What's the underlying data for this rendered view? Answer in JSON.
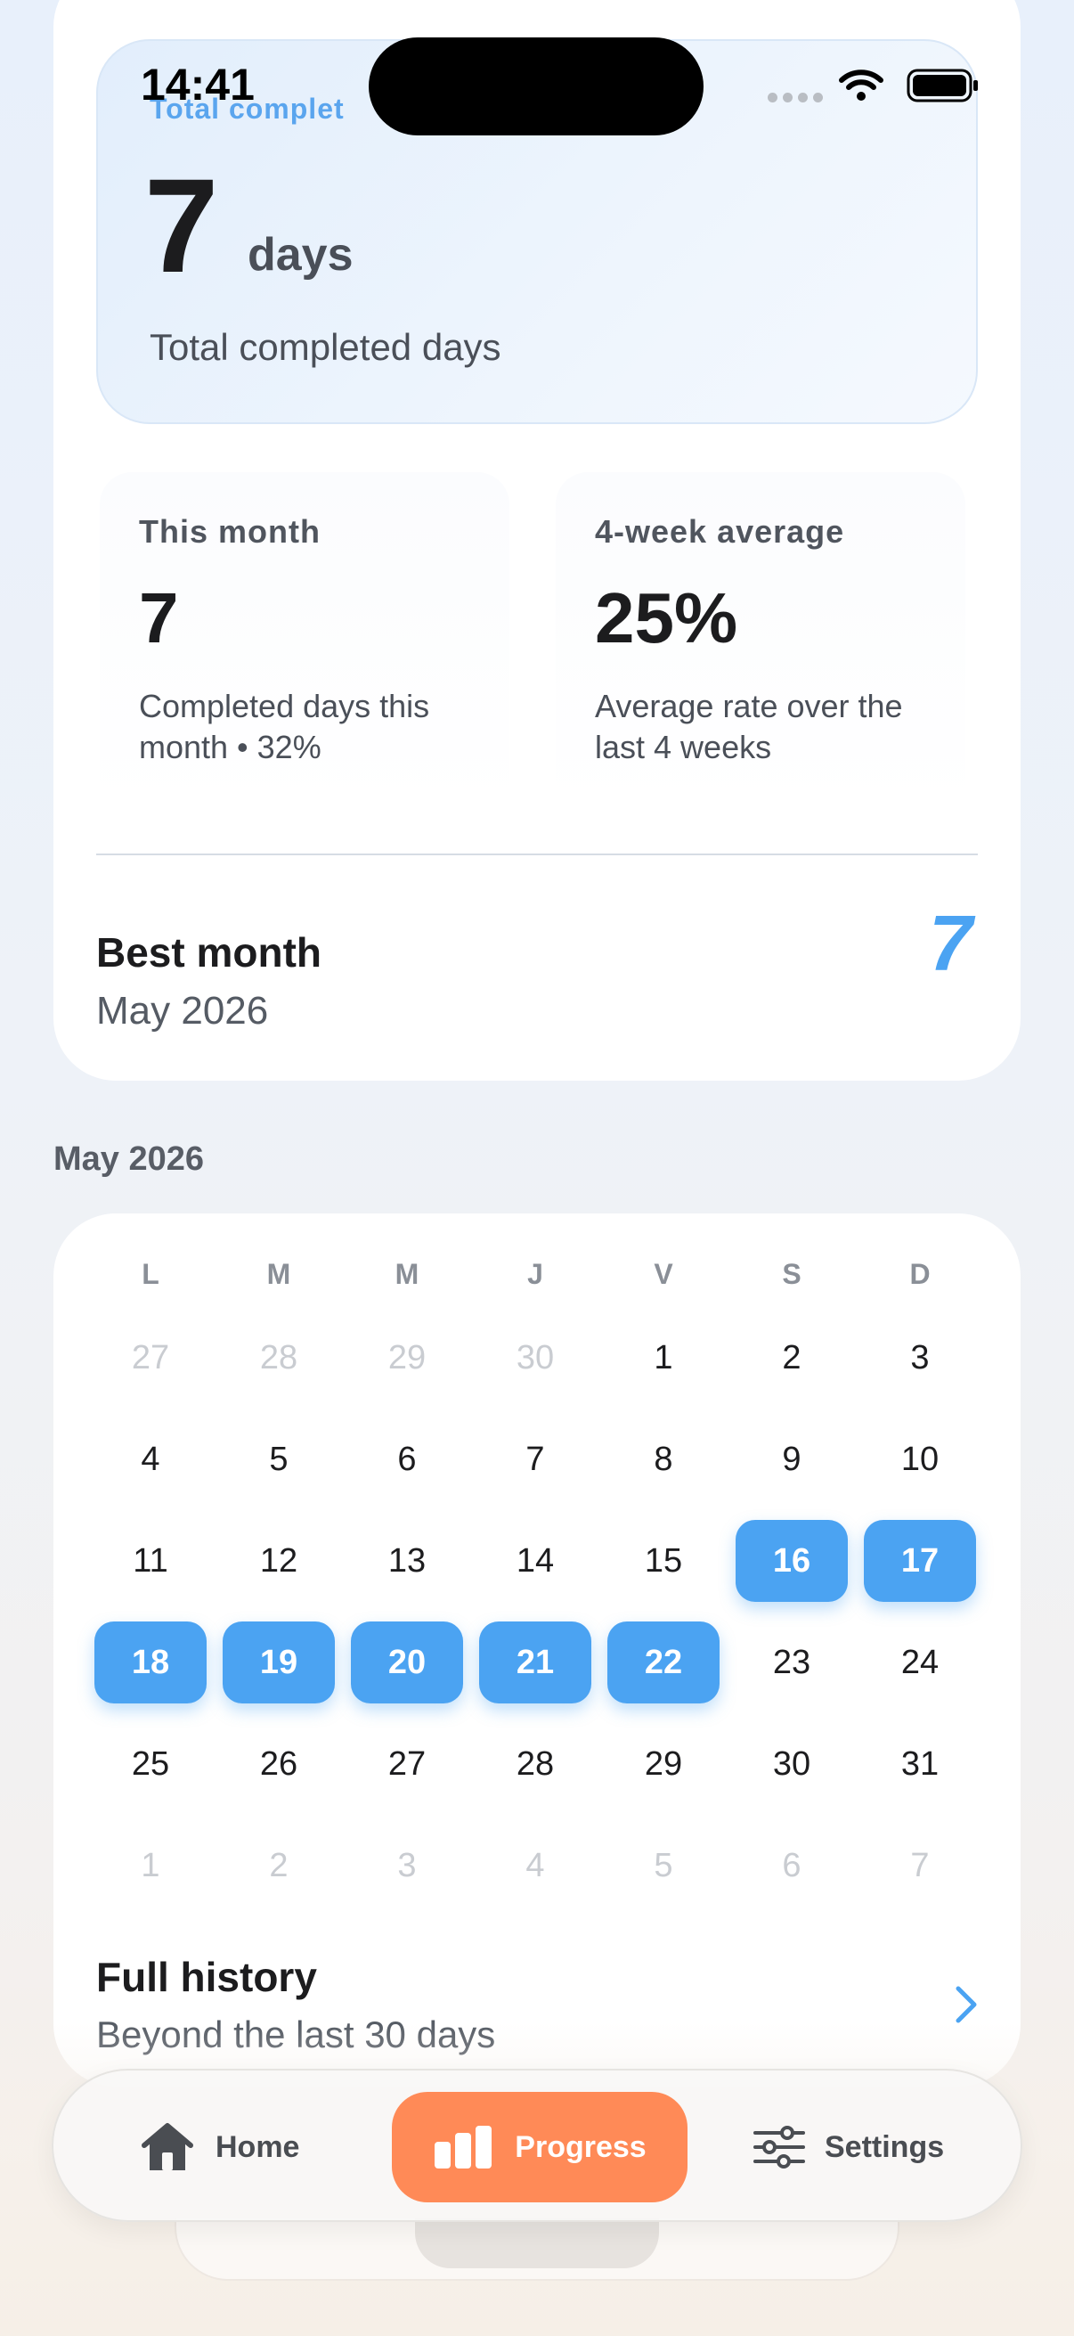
{
  "status_bar": {
    "time": "14:41"
  },
  "summary": {
    "eyebrow": "Total complet",
    "total_value": "7",
    "total_unit": "days",
    "total_caption": "Total completed days",
    "this_month": {
      "title": "This month",
      "value": "7",
      "description": "Completed days this month • 32%"
    },
    "four_week": {
      "title": "4-week average",
      "value": "25%",
      "description": "Average rate over the last 4 weeks"
    },
    "best_month": {
      "title": "Best month",
      "subtitle": "May 2026",
      "value": "7"
    }
  },
  "calendar": {
    "month_label": "May 2026",
    "weekdays": [
      "L",
      "M",
      "M",
      "J",
      "V",
      "S",
      "D"
    ],
    "weeks": [
      [
        {
          "d": "27",
          "muted": true
        },
        {
          "d": "28",
          "muted": true
        },
        {
          "d": "29",
          "muted": true
        },
        {
          "d": "30",
          "muted": true
        },
        {
          "d": "1"
        },
        {
          "d": "2"
        },
        {
          "d": "3"
        }
      ],
      [
        {
          "d": "4"
        },
        {
          "d": "5"
        },
        {
          "d": "6"
        },
        {
          "d": "7"
        },
        {
          "d": "8"
        },
        {
          "d": "9"
        },
        {
          "d": "10"
        }
      ],
      [
        {
          "d": "11"
        },
        {
          "d": "12"
        },
        {
          "d": "13"
        },
        {
          "d": "14"
        },
        {
          "d": "15"
        },
        {
          "d": "16",
          "done": true
        },
        {
          "d": "17",
          "done": true
        }
      ],
      [
        {
          "d": "18",
          "done": true
        },
        {
          "d": "19",
          "done": true
        },
        {
          "d": "20",
          "done": true
        },
        {
          "d": "21",
          "done": true
        },
        {
          "d": "22",
          "done": true
        },
        {
          "d": "23"
        },
        {
          "d": "24"
        }
      ],
      [
        {
          "d": "25"
        },
        {
          "d": "26"
        },
        {
          "d": "27"
        },
        {
          "d": "28"
        },
        {
          "d": "29"
        },
        {
          "d": "30"
        },
        {
          "d": "31"
        }
      ],
      [
        {
          "d": "1",
          "muted": true
        },
        {
          "d": "2",
          "muted": true
        },
        {
          "d": "3",
          "muted": true
        },
        {
          "d": "4",
          "muted": true
        },
        {
          "d": "5",
          "muted": true
        },
        {
          "d": "6",
          "muted": true
        },
        {
          "d": "7",
          "muted": true
        }
      ]
    ],
    "history": {
      "title": "Full history",
      "subtitle": "Beyond the last 30 days"
    }
  },
  "tabbar": {
    "home": {
      "label": "Home",
      "icon": "home-icon"
    },
    "progress": {
      "label": "Progress",
      "icon": "bar-chart-icon",
      "active": true
    },
    "settings": {
      "label": "Settings",
      "icon": "sliders-icon"
    }
  },
  "colors": {
    "accent": "#4ba3f2",
    "active_tab": "#ff8a57"
  }
}
